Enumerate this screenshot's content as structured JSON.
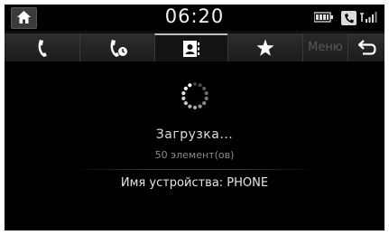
{
  "status_bar": {
    "time": "06:20",
    "icons": [
      "home-icon",
      "battery-icon",
      "bluetooth-phone-icon",
      "signal-icon"
    ]
  },
  "tabs": [
    {
      "name": "call-log-icon",
      "active": false
    },
    {
      "name": "favorites-call-icon",
      "active": false
    },
    {
      "name": "contacts-icon",
      "active": true
    },
    {
      "name": "star-icon",
      "active": false
    }
  ],
  "menu_label": "Меню",
  "back_icon": "back-arrow-icon",
  "content": {
    "loading": "Загрузка...",
    "count": "50 элемент(ов)",
    "device_name": "Имя устройства: PHONE"
  },
  "colors": {
    "background": "#000000",
    "text": "#dddddd",
    "dim_text": "#8a8a8a",
    "disabled": "#5a5a5a"
  }
}
